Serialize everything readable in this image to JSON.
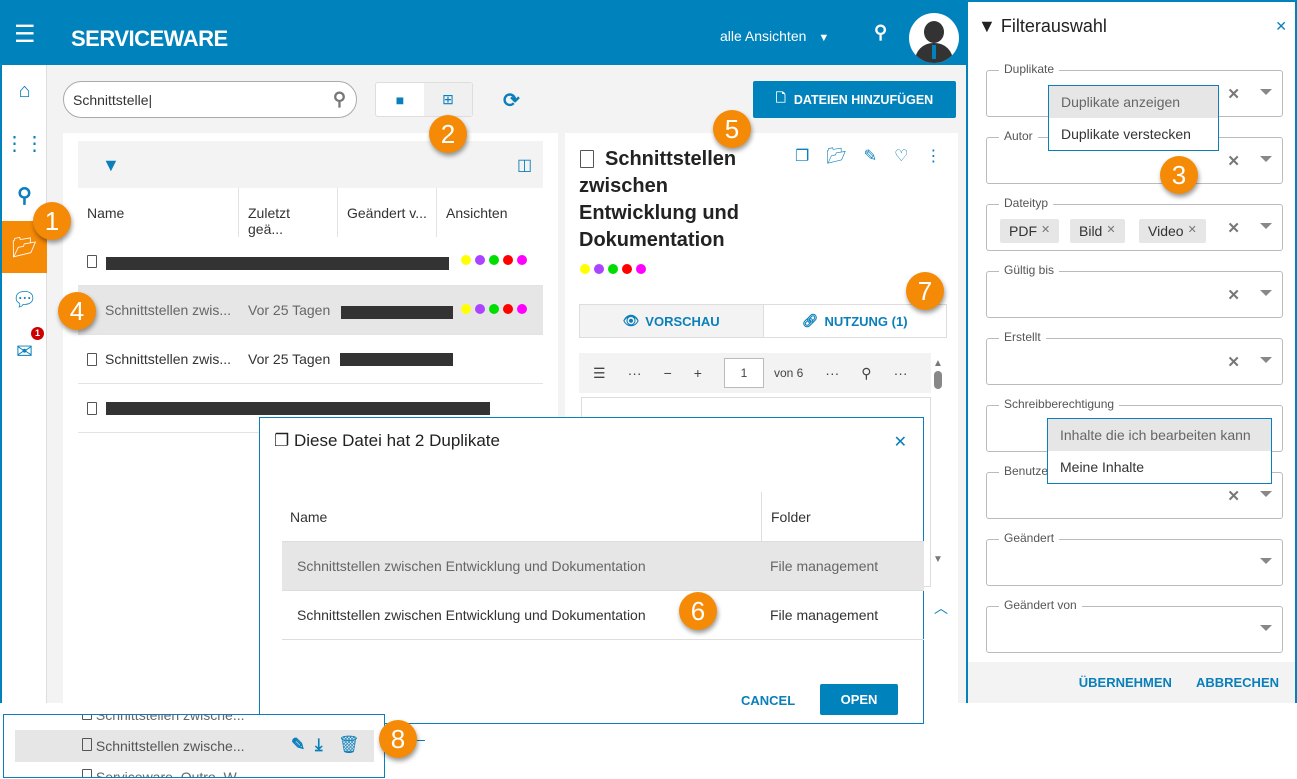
{
  "header": {
    "logo": "SERVICEWARE",
    "views_label": "alle Ansichten",
    "menu_icon": "hamburger-icon",
    "search_icon": "search-icon",
    "avatar": "user-avatar"
  },
  "sidebar": {
    "items": [
      {
        "icon": "home-icon"
      },
      {
        "icon": "tree-icon"
      },
      {
        "icon": "search-icon"
      },
      {
        "icon": "folder-open-icon",
        "active": true
      },
      {
        "icon": "chat-icon"
      },
      {
        "icon": "mail-icon",
        "badge": "1"
      }
    ]
  },
  "toolbar": {
    "search_value": "Schnittstelle",
    "add_files_label": "DATEIEN HINZUFÜGEN"
  },
  "list": {
    "columns": [
      "Name",
      "Zuletzt geä...",
      "Geändert v...",
      "Ansichten"
    ],
    "rows": [
      {
        "name": "",
        "changed": "",
        "dots": true
      },
      {
        "name": "Schnittstellen zwis...",
        "changed": "Vor 25 Tagen",
        "dots": true,
        "selected": true
      },
      {
        "name": "Schnittstellen zwis...",
        "changed": "Vor 25 Tagen",
        "dots": false
      },
      {
        "name": "",
        "changed": "",
        "dots": false
      }
    ]
  },
  "view_colors": [
    "#ffff00",
    "#aa44ff",
    "#00dd00",
    "#ff0000",
    "#ff00ff"
  ],
  "detail": {
    "title": "Schnittstellen zwischen Entwicklung und Dokumentation",
    "tab_preview": "VORSCHAU",
    "tab_usage": "NUTZUNG (1)",
    "page": "1",
    "page_of": "von 6"
  },
  "dialog": {
    "title": "Diese Datei hat 2 Duplikate",
    "columns": [
      "Name",
      "Folder"
    ],
    "rows": [
      {
        "name": "Schnittstellen zwischen Entwicklung und Dokumentation",
        "folder": "File management"
      },
      {
        "name": "Schnittstellen zwischen Entwicklung und Dokumentation",
        "folder": "File management"
      }
    ],
    "cancel": "CANCEL",
    "open": "OPEN"
  },
  "filter": {
    "title": "Filterauswahl",
    "fields": [
      "Duplikate",
      "Autor",
      "Dateityp",
      "Gültig bis",
      "Erstellt",
      "Schreibberechtigung",
      "Benutze",
      "Geändert",
      "Geändert von"
    ],
    "chips": [
      "PDF",
      "Bild",
      "Video"
    ],
    "duplikate_options": [
      "Duplikate anzeigen",
      "Duplikate verstecken"
    ],
    "schreib_options": [
      "Inhalte die ich bearbeiten kann",
      "Meine Inhalte"
    ],
    "apply": "ÜBERNEHMEN",
    "cancel": "ABBRECHEN"
  },
  "snippet": {
    "rows": [
      "Schnittstellen zwische...",
      "Schnittstellen zwische...",
      "Serviceware_Outro_W..."
    ]
  },
  "callouts": [
    "1",
    "2",
    "3",
    "4",
    "5",
    "6",
    "7",
    "8"
  ],
  "accent": "#0082bc",
  "highlight": "#f58a07"
}
